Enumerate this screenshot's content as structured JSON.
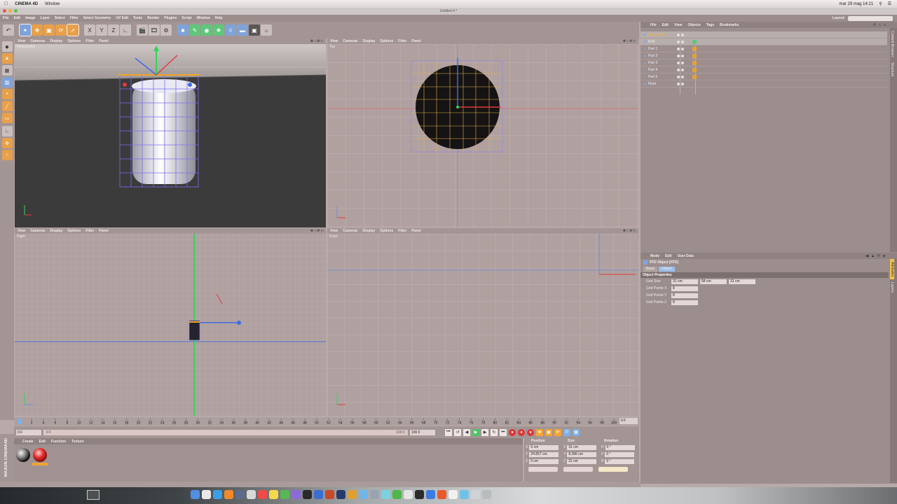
{
  "mac_menubar": {
    "app": "CINEMA 4D",
    "items": [
      "Window"
    ],
    "clock": "mar 29 mag 14:21"
  },
  "window": {
    "title": "Untitled 4 *"
  },
  "app_menu": {
    "items": [
      "File",
      "Edit",
      "Image",
      "Layer",
      "Select",
      "Filter",
      "Select Geometry",
      "UV Edit",
      "Tools",
      "Render",
      "Plugins",
      "Script",
      "Window",
      "Help"
    ],
    "layout_label": "Layout:"
  },
  "viewports": {
    "menu": [
      "View",
      "Cameras",
      "Display",
      "Options",
      "Filter",
      "Panel"
    ],
    "perspective": {
      "label": "Perspective"
    },
    "top": {
      "label": "Top"
    },
    "right": {
      "label": "Right"
    },
    "front": {
      "label": "Front"
    }
  },
  "object_manager": {
    "menu": [
      "File",
      "Edit",
      "View",
      "Objects",
      "Tags",
      "Bookmarks"
    ],
    "objects": [
      {
        "name": "Instrumento",
        "selected": true,
        "root": true,
        "tag": false
      },
      {
        "name": "FFD",
        "selected": true,
        "root": false,
        "tag": true
      },
      {
        "name": "Part 1",
        "selected": false,
        "root": false,
        "tag": true
      },
      {
        "name": "Part 2",
        "selected": false,
        "root": false,
        "tag": true
      },
      {
        "name": "Part 3",
        "selected": false,
        "root": false,
        "tag": true
      },
      {
        "name": "Part 4",
        "selected": false,
        "root": false,
        "tag": true
      },
      {
        "name": "Part 5",
        "selected": false,
        "root": false,
        "tag": true
      },
      {
        "name": "Floor",
        "selected": false,
        "root": false,
        "tag": false
      }
    ],
    "side_tabs": [
      "Content Browser",
      "Structure"
    ]
  },
  "attribute_manager": {
    "menu": [
      "Mode",
      "Edit",
      "User Data"
    ],
    "title": "FFD Object [FFD]",
    "tabs": [
      "Basic",
      "Object"
    ],
    "active_tab": "Object",
    "section": "Object Properties",
    "grid_size_label": "Grid Size",
    "grid_size": [
      "31 cm",
      "58 cm",
      "31 cm"
    ],
    "points": [
      {
        "label": "Grid Points X",
        "value": "8"
      },
      {
        "label": "Grid Points Y",
        "value": "8"
      },
      {
        "label": "Grid Points Z",
        "value": "8"
      }
    ],
    "side_tabs": [
      "Attributes",
      "Layers"
    ]
  },
  "timeline": {
    "ticks": [
      "0",
      "2",
      "4",
      "6",
      "8",
      "10",
      "12",
      "14",
      "16",
      "18",
      "20",
      "22",
      "24",
      "26",
      "28",
      "30",
      "32",
      "34",
      "36",
      "38",
      "40",
      "42",
      "44",
      "46",
      "48",
      "50",
      "52",
      "54",
      "56",
      "58",
      "60",
      "62",
      "64",
      "66",
      "68",
      "70",
      "72",
      "74",
      "76",
      "78",
      "80",
      "82",
      "84",
      "86",
      "88",
      "90",
      "92",
      "94",
      "96",
      "98",
      "100"
    ],
    "current_frame": "0 F",
    "end_frame_field": "0 F",
    "start_field": "0 F",
    "track_start": "0 F",
    "track_end": "100 F",
    "max_field": "100 F"
  },
  "material_manager": {
    "menu": [
      "Create",
      "Edit",
      "Function",
      "Texture"
    ]
  },
  "coordinates": {
    "headers": [
      "Position",
      "Size",
      "Rotation"
    ],
    "rows": [
      {
        "pos_axis": "X",
        "pos": "0 cm",
        "size_axis": "X",
        "size": "31 cm",
        "rot_axis": "H",
        "rot": "0 °"
      },
      {
        "pos_axis": "Y",
        "pos": "24.857 cm",
        "size_axis": "Y",
        "size": "8.286 cm",
        "rot_axis": "P",
        "rot": "0 °"
      },
      {
        "pos_axis": "Z",
        "pos": "0 cm",
        "size_axis": "Z",
        "size": "31 cm",
        "rot_axis": "B",
        "rot": "0 °"
      }
    ]
  },
  "brand": "MAXON CINEMA4D",
  "colors": {
    "accent": "#f0b43a",
    "selection": "#7fa6e3",
    "axis_x": "#e23b3b",
    "axis_y": "#3ad15a",
    "axis_z": "#3f6de0"
  }
}
